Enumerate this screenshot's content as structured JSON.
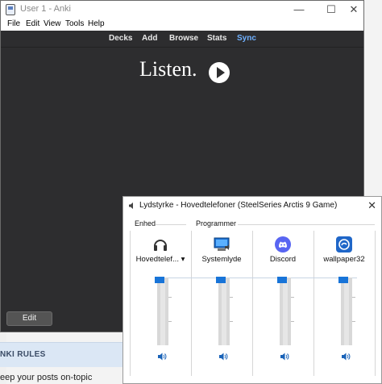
{
  "background": {
    "rules_label": "NKI RULES",
    "posts_text": "eep your posts on-topic"
  },
  "anki": {
    "title": "User 1 - Anki",
    "window_controls": {
      "minimize": "—",
      "maximize": "☐",
      "close": "✕"
    },
    "menu": [
      "File",
      "Edit",
      "View",
      "Tools",
      "Help"
    ],
    "toolbar": [
      "Decks",
      "Add",
      "Browse",
      "Stats",
      "Sync"
    ],
    "card_text": "Listen.",
    "edit_label": "Edit"
  },
  "mixer": {
    "title": "Lydstyrke - Hovedtelefoner (SteelSeries Arctis 9 Game)",
    "close": "✕",
    "device_section": "Enhed",
    "apps_section": "Programmer",
    "channels": [
      {
        "label": "Hovedtelef... ▾",
        "icon": "headphones-icon",
        "volume": 0.97
      },
      {
        "label": "Systemlyde",
        "icon": "system-sounds-icon",
        "volume": 0.97
      },
      {
        "label": "Discord",
        "icon": "discord-icon",
        "volume": 0.97
      },
      {
        "label": "wallpaper32",
        "icon": "wallpaper-engine-icon",
        "volume": 0.97
      }
    ]
  },
  "colors": {
    "accent": "#1874d8",
    "sync": "#6fb0ff",
    "anki_bg": "#2d2d2f"
  }
}
